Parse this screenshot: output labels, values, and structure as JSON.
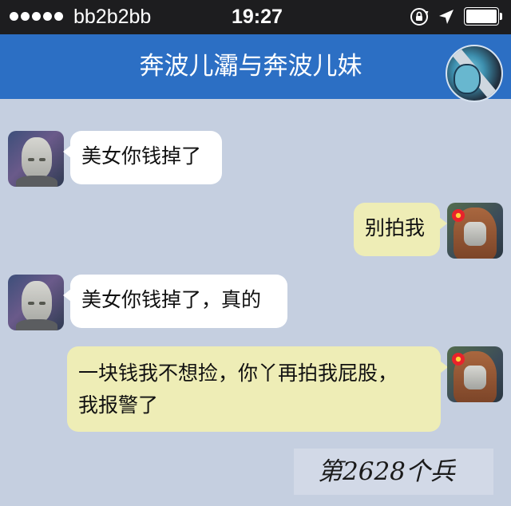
{
  "status_bar": {
    "signal_bars": 5,
    "carrier": "bb2b2bb",
    "time": "19:27",
    "icons": [
      "rotation-lock-icon",
      "location-arrow-icon",
      "battery-icon"
    ],
    "battery_level": 1.0
  },
  "nav": {
    "title": "奔波儿灞与奔波儿妹"
  },
  "messages": [
    {
      "side": "left",
      "sender": "male",
      "text": "美女你钱掉了"
    },
    {
      "side": "right",
      "sender": "female",
      "text": "别拍我"
    },
    {
      "side": "left",
      "sender": "male",
      "text": "美女你钱掉了，真的"
    },
    {
      "side": "right",
      "sender": "female",
      "text": "一块钱我不想捡，你丫再拍我屁股，\n我报警了"
    }
  ],
  "watermark": "第2628个兵",
  "colors": {
    "nav_bar": "#2c6fc4",
    "background": "#c5cfe0",
    "incoming_bubble": "#ffffff",
    "outgoing_bubble": "#eeedb6"
  }
}
